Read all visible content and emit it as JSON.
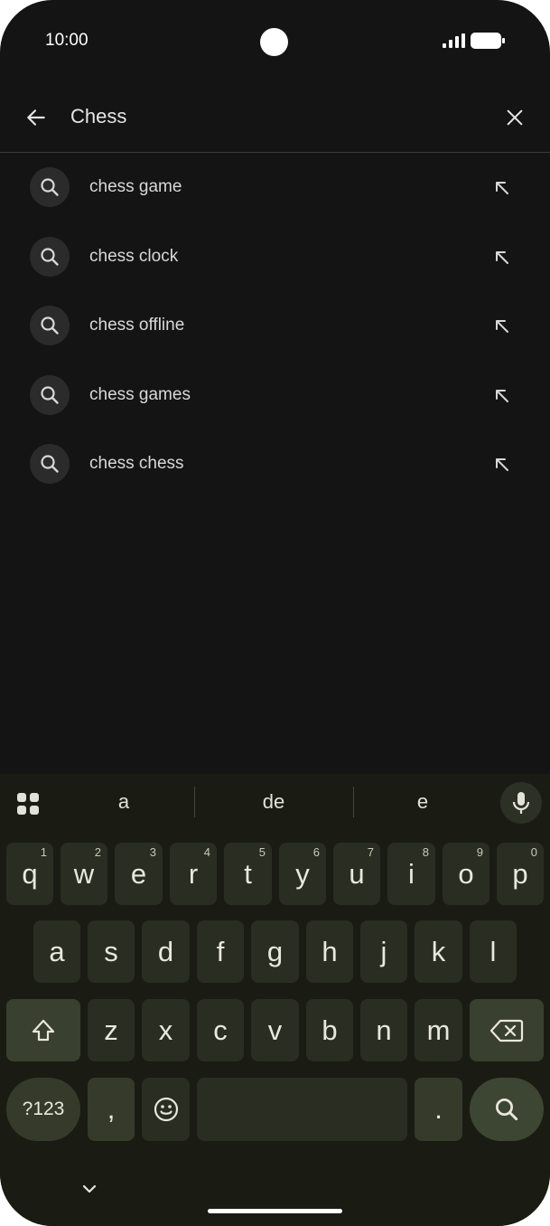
{
  "status_bar": {
    "time": "10:00"
  },
  "search": {
    "query": "Chess"
  },
  "suggestions": [
    {
      "label": "chess game"
    },
    {
      "label": "chess clock"
    },
    {
      "label": "chess offline"
    },
    {
      "label": "chess games"
    },
    {
      "label": "chess chess"
    }
  ],
  "keyboard": {
    "predictions": [
      "a",
      "de",
      "e"
    ],
    "row1": [
      {
        "key": "q",
        "hint": "1"
      },
      {
        "key": "w",
        "hint": "2"
      },
      {
        "key": "e",
        "hint": "3"
      },
      {
        "key": "r",
        "hint": "4"
      },
      {
        "key": "t",
        "hint": "5"
      },
      {
        "key": "y",
        "hint": "6"
      },
      {
        "key": "u",
        "hint": "7"
      },
      {
        "key": "i",
        "hint": "8"
      },
      {
        "key": "o",
        "hint": "9"
      },
      {
        "key": "p",
        "hint": "0"
      }
    ],
    "row2": [
      "a",
      "s",
      "d",
      "f",
      "g",
      "h",
      "j",
      "k",
      "l"
    ],
    "row3": [
      "z",
      "x",
      "c",
      "v",
      "b",
      "n",
      "m"
    ],
    "sym_label": "?123",
    "comma": ",",
    "period": "."
  },
  "colors": {
    "background": "#141414",
    "keyboard_bg": "#1a1c14",
    "key_bg": "#2a2d22",
    "accent_key": "#3a4030"
  }
}
